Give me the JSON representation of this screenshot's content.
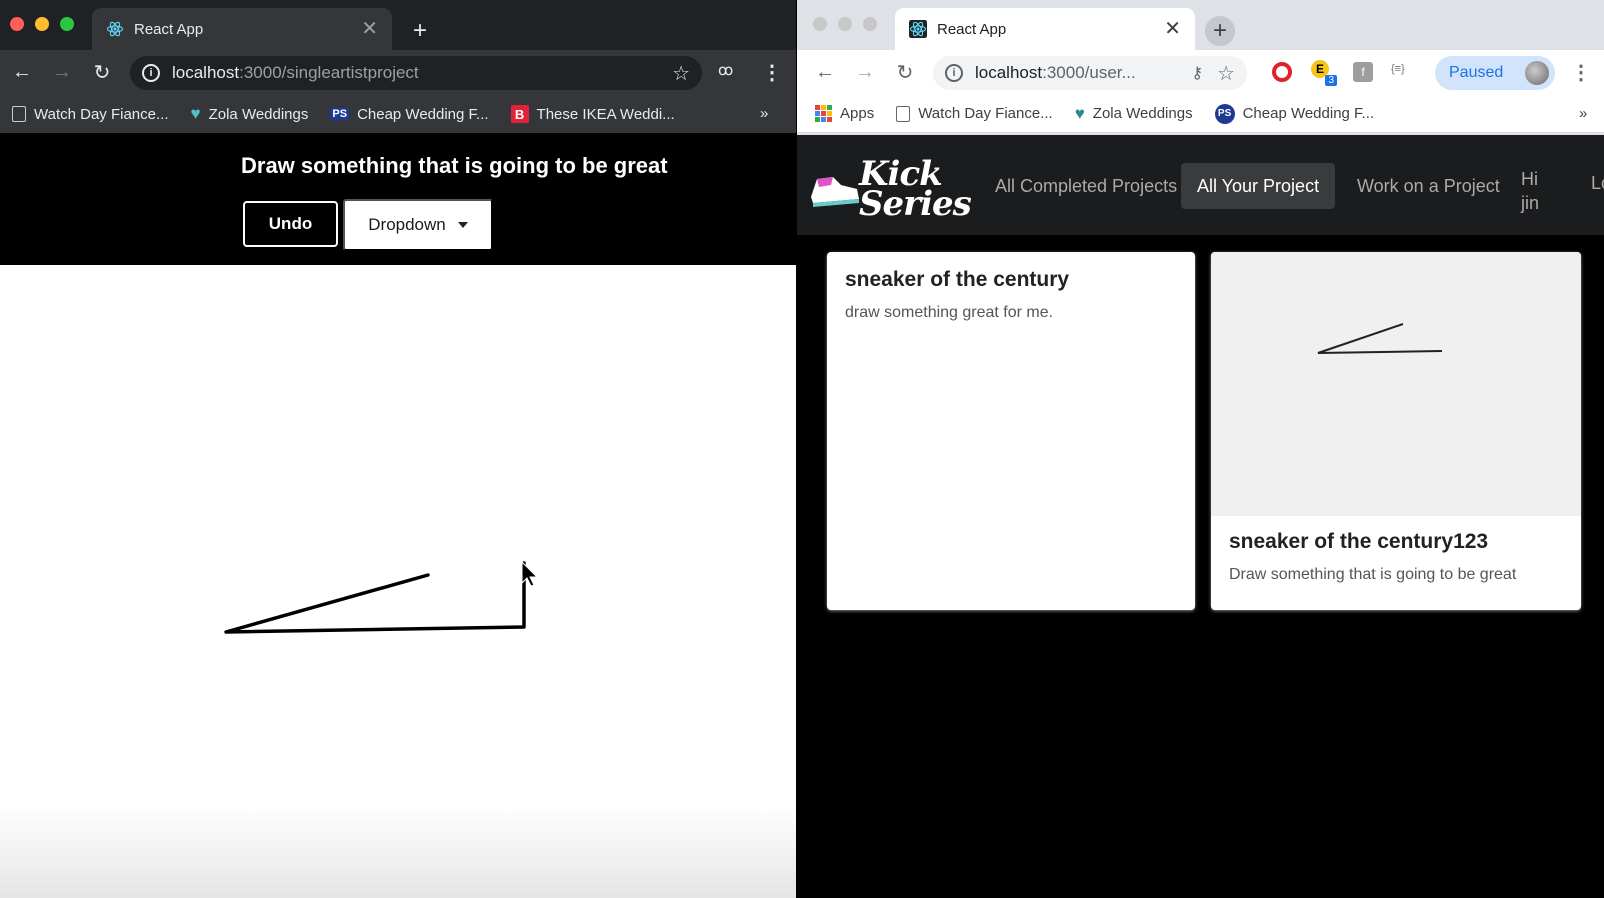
{
  "left_window": {
    "tab": {
      "title": "React App",
      "close": "✕"
    },
    "new_tab": "+",
    "url": {
      "host": "localhost",
      "path": ":3000/singleartistproject"
    },
    "bookmarks": [
      {
        "icon": "page-icon",
        "label": "Watch Day Fiance..."
      },
      {
        "icon": "heart-icon",
        "label": "Zola Weddings"
      },
      {
        "icon": "ps-icon",
        "label": "Cheap Wedding F..."
      },
      {
        "icon": "b-icon",
        "label": "These IKEA Weddi..."
      }
    ],
    "more": "»",
    "page": {
      "title": "Draw something that is going to be great",
      "undo_label": "Undo",
      "dropdown_label": "Dropdown"
    }
  },
  "right_window": {
    "tab": {
      "title": "React App",
      "close": "✕"
    },
    "new_tab": "+",
    "url": {
      "host": "localhost",
      "path": ":3000/user..."
    },
    "profile_label": "Paused",
    "extension_badge": "3",
    "bookmarks": [
      {
        "icon": "apps-icon",
        "label": "Apps"
      },
      {
        "icon": "page-icon",
        "label": "Watch Day Fiance..."
      },
      {
        "icon": "heart-icon",
        "label": "Zola Weddings"
      },
      {
        "icon": "ps-icon",
        "label": "Cheap Wedding F..."
      }
    ],
    "more": "»",
    "page": {
      "logo_text": "Kick Series",
      "nav": [
        {
          "label": "All Completed Projects",
          "active": false
        },
        {
          "label": "All Your Project",
          "active": true
        },
        {
          "label": "Work on a Project",
          "active": false
        }
      ],
      "greeting": "Hi jin",
      "logout_partial": "Lo",
      "cards": [
        {
          "title": "sneaker of the century",
          "description": "draw something great for me."
        },
        {
          "title": "sneaker of the century123",
          "description": "Draw something that is going to be great"
        }
      ]
    }
  },
  "colors": {
    "dark_chrome": "#202124",
    "light_chrome": "#dee1e6",
    "page_header": "#000000",
    "profile_chip": "#d2e3fc",
    "accent_blue": "#1a73e8"
  }
}
